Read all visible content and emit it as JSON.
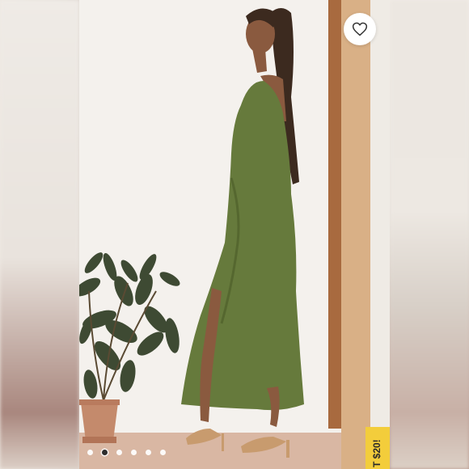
{
  "listing": {
    "favorite_icon": "heart-outline-icon",
    "gallery": {
      "dot_count": 6,
      "active_index": 1
    },
    "promo_label": "T $20!"
  },
  "colors": {
    "dress": "#667a3c",
    "promo_bg": "#f3cd3b",
    "door": "#d9b086",
    "door_frame": "#a86a3f"
  }
}
